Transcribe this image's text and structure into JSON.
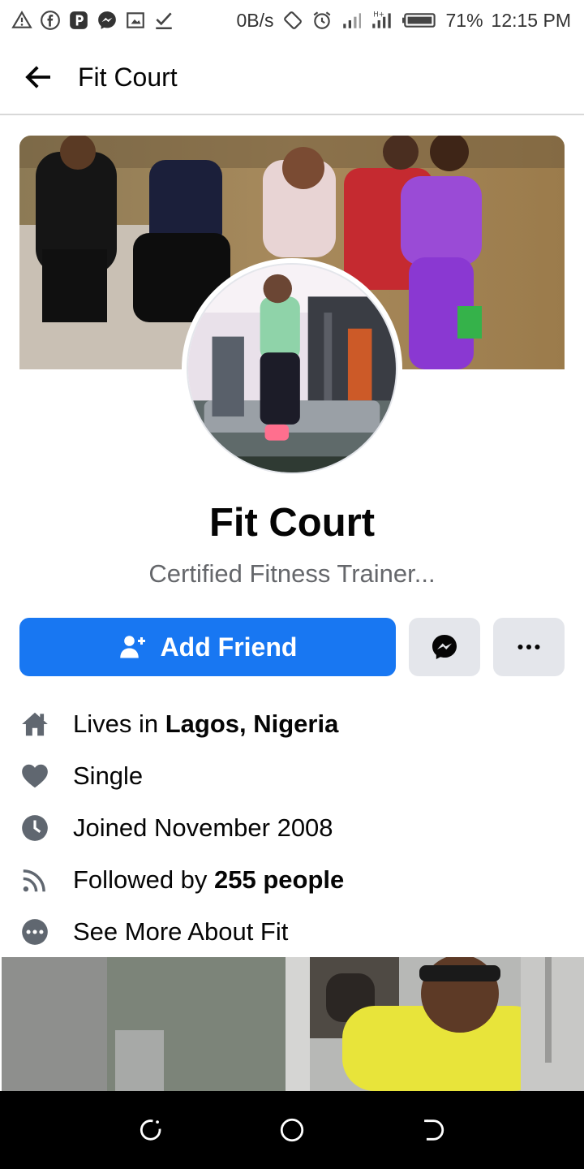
{
  "status_bar": {
    "net_speed": "0B/s",
    "battery": "71%",
    "time": "12:15 PM",
    "icons": [
      "alert-triangle-icon",
      "facebook-icon",
      "p-app-icon",
      "messenger-icon",
      "screenshot-icon",
      "check-icon",
      "rotate-icon",
      "alarm-icon",
      "signal-icon",
      "signal-h-icon",
      "battery-icon"
    ]
  },
  "appbar": {
    "title": "Fit Court",
    "back_icon": "arrow-left-icon"
  },
  "profile": {
    "name": "Fit Court",
    "bio": "Certified Fitness Trainer..."
  },
  "actions": {
    "add_friend": "Add Friend",
    "add_friend_icon": "person-add-icon",
    "message_icon": "messenger-icon",
    "more_icon": "more-dots-icon",
    "accent": "#1877f2"
  },
  "info": {
    "lives_prefix": "Lives in ",
    "lives_place": "Lagos, Nigeria",
    "relationship": "Single",
    "joined": "Joined November 2008",
    "followed_prefix": "Followed by ",
    "followed_count": "255 people",
    "see_more": "See More About Fit"
  },
  "navbar": {
    "icons": [
      "recent-apps-icon",
      "home-circle-icon",
      "back-nav-icon"
    ]
  }
}
